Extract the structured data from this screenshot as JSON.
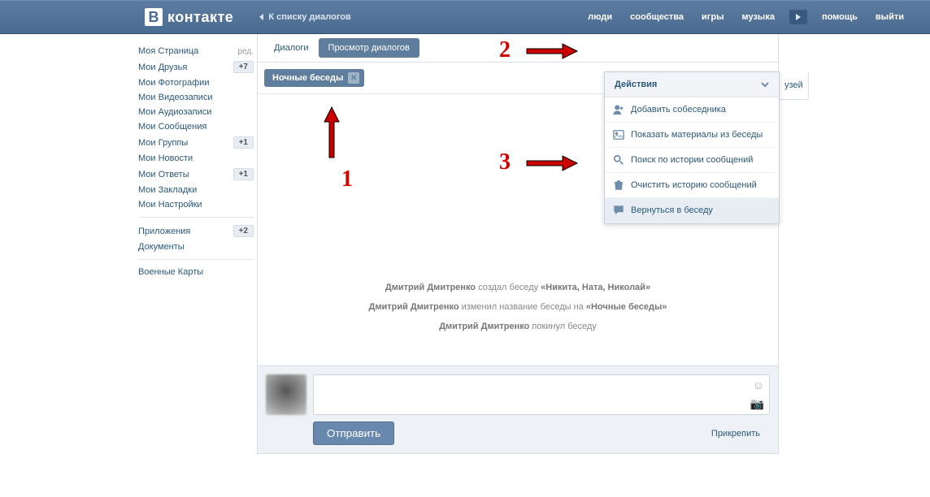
{
  "header": {
    "brand": "контакте",
    "back": "К списку диалогов",
    "nav": {
      "people": "люди",
      "communities": "сообщества",
      "games": "игры",
      "music": "музыка",
      "help": "помощь",
      "exit": "выйти"
    }
  },
  "sidebar": {
    "edit": "ред.",
    "items": {
      "my_page": "Моя Страница",
      "my_friends": "Мои Друзья",
      "my_photos": "Мои Фотографии",
      "my_videos": "Мои Видеозаписи",
      "my_audio": "Мои Аудиозаписи",
      "my_messages": "Мои Сообщения",
      "my_groups": "Мои Группы",
      "my_news": "Мои Новости",
      "my_answers": "Мои Ответы",
      "my_bookmarks": "Мои Закладки",
      "my_settings": "Мои Настройки",
      "apps": "Приложения",
      "docs": "Документы",
      "cards": "Военные Карты"
    },
    "counts": {
      "friends": "+7",
      "groups": "+1",
      "answers": "+1",
      "apps": "+2"
    }
  },
  "tabs": {
    "dialogs": "Диалоги",
    "view": "Просмотр диалогов",
    "right_cut": "узей"
  },
  "chip": {
    "label": "Ночные беседы"
  },
  "dropdown": {
    "head": "Действия",
    "add": "Добавить собеседника",
    "media": "Показать материалы из беседы",
    "search": "Поиск по истории сообщений",
    "clear": "Очистить историю сообщений",
    "back": "Вернуться в беседу"
  },
  "messages": {
    "actor": "Дмитрий Дмитренко",
    "created_mid": " создал беседу ",
    "created_name": "«Никита, Ната, Николай»",
    "renamed_mid": " изменил название беседы на ",
    "renamed_name": "«Ночные беседы»",
    "left": " покинул беседу"
  },
  "compose": {
    "send": "Отправить",
    "attach": "Прикрепить"
  },
  "ann": {
    "n1": "1",
    "n2": "2",
    "n3": "3"
  }
}
